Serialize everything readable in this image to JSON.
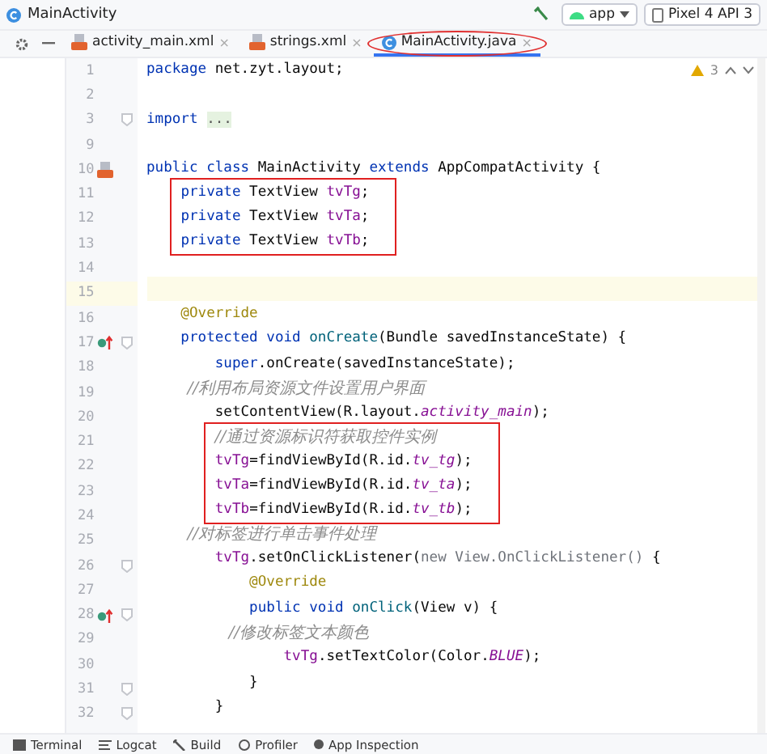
{
  "window": {
    "title": "MainActivity"
  },
  "toolbar": {
    "config": "app",
    "device": "Pixel 4 API 3"
  },
  "tabs": [
    {
      "label": "activity_main.xml",
      "kind": "xml",
      "close": "×",
      "selected": false,
      "circled": false
    },
    {
      "label": "strings.xml",
      "kind": "xml",
      "close": "×",
      "selected": false,
      "circled": false
    },
    {
      "label": "MainActivity.java",
      "kind": "class",
      "close": "×",
      "selected": true,
      "circled": true
    }
  ],
  "inspection": {
    "warnings": "3"
  },
  "blocks": [
    {
      "boxed": false,
      "lines": [
        {
          "number": "1",
          "kind": "code",
          "segments": [
            {
              "kind": "keyword",
              "text": "package"
            },
            {
              "kind": "plain",
              "text": " net.zyt.layout;"
            }
          ]
        },
        {
          "number": "2",
          "kind": "code"
        },
        {
          "number": "3",
          "kind": "code",
          "fold": true,
          "segments": [
            {
              "kind": "keyword",
              "text": "import "
            },
            {
              "kind": "folded",
              "text": "..."
            }
          ]
        },
        {
          "number": "9",
          "kind": "code"
        },
        {
          "number": "10",
          "kind": "xml-link",
          "segments": [
            {
              "kind": "keyword",
              "text": "public class"
            },
            {
              "kind": "plain",
              "text": " MainActivity "
            },
            {
              "kind": "keyword",
              "text": "extends"
            },
            {
              "kind": "plain",
              "text": " AppCompatActivity {"
            }
          ]
        }
      ]
    },
    {
      "boxed": true,
      "lines": [
        {
          "number": "11",
          "kind": "code",
          "segments": [
            {
              "kind": "keyword",
              "text": "    private"
            },
            {
              "kind": "plain",
              "text": " TextView "
            },
            {
              "kind": "field",
              "text": "tvTg"
            },
            {
              "kind": "plain",
              "text": ";"
            }
          ]
        },
        {
          "number": "12",
          "kind": "code",
          "segments": [
            {
              "kind": "keyword",
              "text": "    private"
            },
            {
              "kind": "plain",
              "text": " TextView "
            },
            {
              "kind": "field",
              "text": "tvTa"
            },
            {
              "kind": "plain",
              "text": ";"
            }
          ]
        },
        {
          "number": "13",
          "kind": "code",
          "segments": [
            {
              "kind": "keyword",
              "text": "    private"
            },
            {
              "kind": "plain",
              "text": " TextView "
            },
            {
              "kind": "field",
              "text": "tvTb"
            },
            {
              "kind": "plain",
              "text": ";"
            }
          ]
        }
      ]
    },
    {
      "boxed": false,
      "lines": [
        {
          "number": "14",
          "kind": "code"
        },
        {
          "number": "15",
          "kind": "code",
          "current": true
        },
        {
          "number": "16",
          "kind": "code",
          "segments": [
            {
              "kind": "annotation",
              "text": "    @Override"
            }
          ]
        },
        {
          "number": "17",
          "kind": "override",
          "fold": true,
          "segments": [
            {
              "kind": "keyword",
              "text": "    protected void "
            },
            {
              "kind": "method",
              "text": "onCreate"
            },
            {
              "kind": "plain",
              "text": "(Bundle savedInstanceState) {"
            }
          ]
        },
        {
          "number": "18",
          "kind": "code",
          "segments": [
            {
              "kind": "keyword",
              "text": "        super"
            },
            {
              "kind": "plain",
              "text": ".onCreate(savedInstanceState);"
            }
          ]
        },
        {
          "number": "19",
          "kind": "code",
          "segments": [
            {
              "kind": "comment",
              "text": "        //利用布局资源文件设置用户界面"
            }
          ]
        },
        {
          "number": "20",
          "kind": "code",
          "segments": [
            {
              "kind": "plain",
              "text": "        setContentView(R.layout."
            },
            {
              "kind": "static",
              "text": "activity_main"
            },
            {
              "kind": "plain",
              "text": ");"
            }
          ]
        }
      ]
    },
    {
      "boxed": true,
      "lines": [
        {
          "number": "21",
          "kind": "code",
          "segments": [
            {
              "kind": "comment",
              "text": "        //通过资源标识符获取控件实例"
            }
          ]
        },
        {
          "number": "22",
          "kind": "code",
          "segments": [
            {
              "kind": "field",
              "text": "        tvTg"
            },
            {
              "kind": "plain",
              "text": "=findViewById(R.id."
            },
            {
              "kind": "static",
              "text": "tv_tg"
            },
            {
              "kind": "plain",
              "text": ");"
            }
          ]
        },
        {
          "number": "23",
          "kind": "code",
          "segments": [
            {
              "kind": "field",
              "text": "        tvTa"
            },
            {
              "kind": "plain",
              "text": "=findViewById(R.id."
            },
            {
              "kind": "static",
              "text": "tv_ta"
            },
            {
              "kind": "plain",
              "text": ");"
            }
          ]
        },
        {
          "number": "24",
          "kind": "code",
          "segments": [
            {
              "kind": "field",
              "text": "        tvTb"
            },
            {
              "kind": "plain",
              "text": "=findViewById(R.id."
            },
            {
              "kind": "static",
              "text": "tv_tb"
            },
            {
              "kind": "plain",
              "text": ");"
            }
          ]
        }
      ]
    },
    {
      "boxed": false,
      "lines": [
        {
          "number": "25",
          "kind": "code",
          "segments": [
            {
              "kind": "comment",
              "text": "        //对标签进行单击事件处理"
            }
          ]
        },
        {
          "number": "26",
          "kind": "code",
          "fold": true,
          "segments": [
            {
              "kind": "field",
              "text": "        tvTg"
            },
            {
              "kind": "plain",
              "text": ".setOnClickListener("
            },
            {
              "kind": "muted",
              "text": "new View.OnClickListener()"
            },
            {
              "kind": "plain",
              "text": " {"
            }
          ]
        },
        {
          "number": "27",
          "kind": "code",
          "segments": [
            {
              "kind": "annotation",
              "text": "            @Override"
            }
          ]
        },
        {
          "number": "28",
          "kind": "override",
          "fold": true,
          "segments": [
            {
              "kind": "keyword",
              "text": "            public void "
            },
            {
              "kind": "method",
              "text": "onClick"
            },
            {
              "kind": "plain",
              "text": "(View v) {"
            }
          ]
        },
        {
          "number": "29",
          "kind": "code",
          "segments": [
            {
              "kind": "comment",
              "text": "                //修改标签文本颜色"
            }
          ]
        },
        {
          "number": "30",
          "kind": "code",
          "segments": [
            {
              "kind": "field",
              "text": "                tvTg"
            },
            {
              "kind": "plain",
              "text": ".setTextColor(Color."
            },
            {
              "kind": "static",
              "text": "BLUE"
            },
            {
              "kind": "plain",
              "text": ");"
            }
          ]
        },
        {
          "number": "31",
          "kind": "code",
          "fold": true,
          "segments": [
            {
              "kind": "plain",
              "text": "            }"
            }
          ]
        },
        {
          "number": "32",
          "kind": "code",
          "fold": true,
          "segments": [
            {
              "kind": "plain",
              "text": "        }"
            }
          ]
        }
      ]
    }
  ],
  "bottom_tools": [
    {
      "label": "Terminal",
      "kind": "terminal"
    },
    {
      "label": "Logcat",
      "kind": "logcat"
    },
    {
      "label": "Build",
      "kind": "build"
    },
    {
      "label": "Profiler",
      "kind": "profiler"
    },
    {
      "label": "App Inspection",
      "kind": "inspect"
    }
  ]
}
